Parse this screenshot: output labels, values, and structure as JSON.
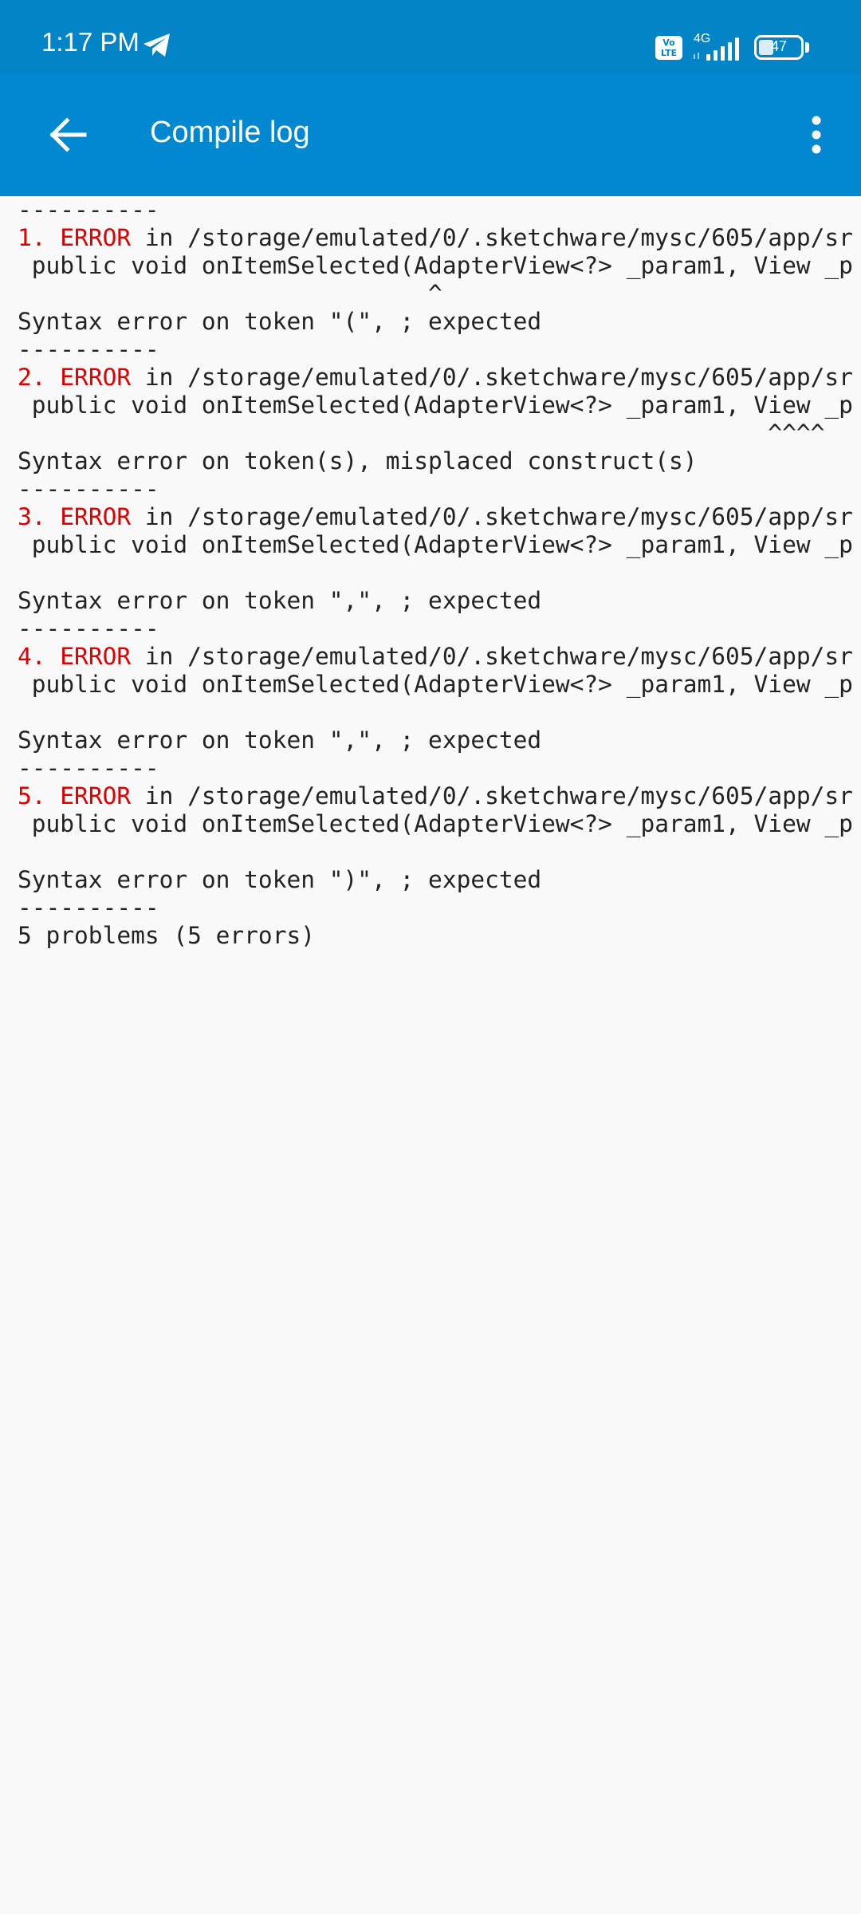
{
  "status_bar": {
    "time": "1:17 PM",
    "volte": "Vo LTE",
    "network": "4G",
    "battery": "47"
  },
  "app_bar": {
    "title": "Compile log",
    "back_icon": "arrow-left-icon",
    "menu_icon": "more-vert-icon"
  },
  "log": {
    "separator": "----------",
    "errors": [
      {
        "number": "1.",
        "label": "ERROR",
        "location": " in /storage/emulated/0/.sketchware/mysc/605/app/sr",
        "code": " public void onItemSelected(AdapterView<?> _param1, View _p",
        "marker": "                             ^",
        "message": "Syntax error on token \"(\", ; expected"
      },
      {
        "number": "2.",
        "label": "ERROR",
        "location": " in /storage/emulated/0/.sketchware/mysc/605/app/sr",
        "code": " public void onItemSelected(AdapterView<?> _param1, View _p",
        "marker": "                                                     ^^^^",
        "message": "Syntax error on token(s), misplaced construct(s)"
      },
      {
        "number": "3.",
        "label": "ERROR",
        "location": " in /storage/emulated/0/.sketchware/mysc/605/app/sr",
        "code": " public void onItemSelected(AdapterView<?> _param1, View _p",
        "marker": "",
        "message": "Syntax error on token \",\", ; expected"
      },
      {
        "number": "4.",
        "label": "ERROR",
        "location": " in /storage/emulated/0/.sketchware/mysc/605/app/sr",
        "code": " public void onItemSelected(AdapterView<?> _param1, View _p",
        "marker": "",
        "message": "Syntax error on token \",\", ; expected"
      },
      {
        "number": "5.",
        "label": "ERROR",
        "location": " in /storage/emulated/0/.sketchware/mysc/605/app/sr",
        "code": " public void onItemSelected(AdapterView<?> _param1, View _p",
        "marker": "",
        "message": "Syntax error on token \")\", ; expected"
      }
    ],
    "summary": "5 problems (5 errors)"
  },
  "colors": {
    "status_bar": "#0284c7",
    "app_bar": "#0288d1",
    "error": "#e00000",
    "background": "#f9f9f9"
  }
}
